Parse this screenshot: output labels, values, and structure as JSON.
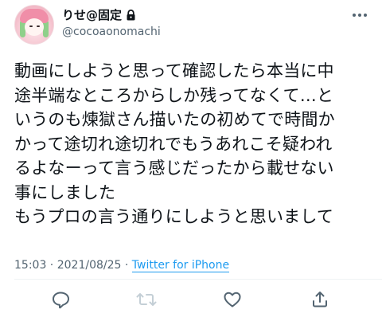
{
  "author": {
    "display_name": "りせ@固定",
    "handle": "@cocoaonomachi",
    "avatar_icon": "avatar-anime-pink-hair"
  },
  "tweet": {
    "lines": [
      "動画にしようと思って確認したら本当に中",
      "途半端なところからしか残ってなくて…と",
      "いうのも煉獄さん描いたの初めてで時間か",
      "かって途切れ途切れでもうあれこそ疑われ",
      "るよなーって言う感じだったから載せない",
      "事にしました",
      "もうプロの言う通りにしようと思いまして"
    ]
  },
  "meta": {
    "time": "15:03",
    "separator1": " · ",
    "date": "2021/08/25",
    "separator2": " · ",
    "source": "Twitter for iPhone"
  },
  "icons": {
    "lock": "lock-icon",
    "more": "more-icon",
    "reply": "reply-icon",
    "retweet": "retweet-icon",
    "like": "like-icon",
    "share": "share-icon"
  },
  "colors": {
    "text": "#0f1419",
    "secondary": "#536471",
    "link": "#1d9bf0",
    "divider": "#eff3f4"
  }
}
